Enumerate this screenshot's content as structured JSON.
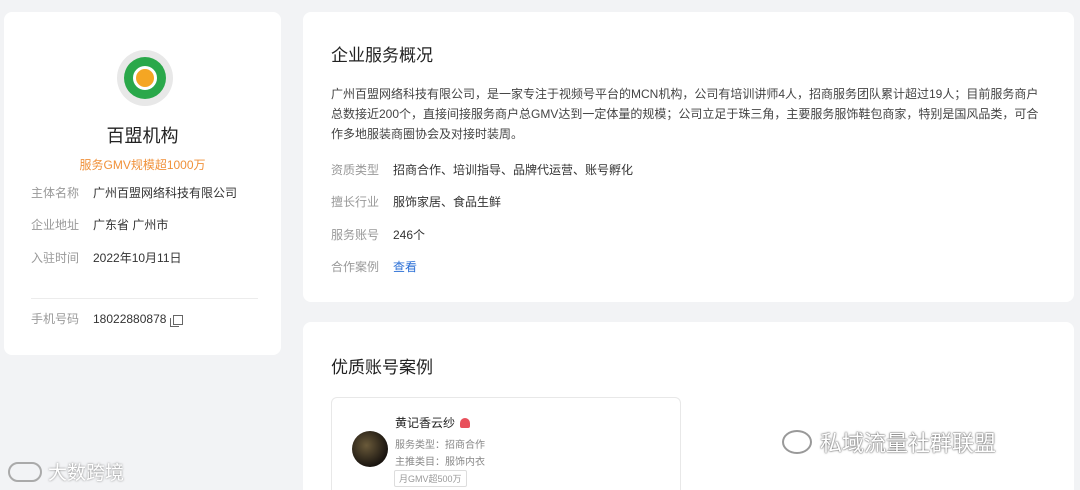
{
  "profile": {
    "logo_icon": "mcn-logo-icon",
    "name": "百盟机构",
    "gmv": "服务GMV规模超1000万",
    "fields": [
      {
        "label": "主体名称",
        "value": "广州百盟网络科技有限公司"
      },
      {
        "label": "企业地址",
        "value": "广东省 广州市"
      },
      {
        "label": "入驻时间",
        "value": "2022年10月11日"
      }
    ],
    "phone_label": "手机号码",
    "phone_value": "18022880878",
    "copy_icon": "copy-icon"
  },
  "overview": {
    "title": "企业服务概况",
    "description": "广州百盟网络科技有限公司，是一家专注于视频号平台的MCN机构，公司有培训讲师4人，招商服务团队累计超过19人；目前服务商户总数接近200个，直接间接服务商户总GMV达到一定体量的规模；公司立足于珠三角，主要服务服饰鞋包商家，特别是国风品类，可合作多地服装商圈协会及对接时装周。",
    "attrs": [
      {
        "label": "资质类型",
        "value": "招商合作、培训指导、品牌代运营、账号孵化"
      },
      {
        "label": "擅长行业",
        "value": "服饰家居、食品生鲜"
      },
      {
        "label": "服务账号",
        "value": "246个"
      }
    ],
    "cases_label": "合作案例",
    "cases_link": "查看"
  },
  "cases": {
    "title": "优质账号案例",
    "items": [
      {
        "name": "黄记香云纱",
        "live_icon": "live-icon",
        "service_type": "服务类型：招商合作",
        "category": "主推类目：服饰内衣",
        "tag": "月GMV超500万"
      }
    ]
  },
  "watermarks": {
    "right": "私域流量社群联盟",
    "left": "大数跨境"
  },
  "colors": {
    "accent_orange": "#f0913a",
    "link_blue": "#2b6fd6",
    "background": "#f2f3f5"
  }
}
